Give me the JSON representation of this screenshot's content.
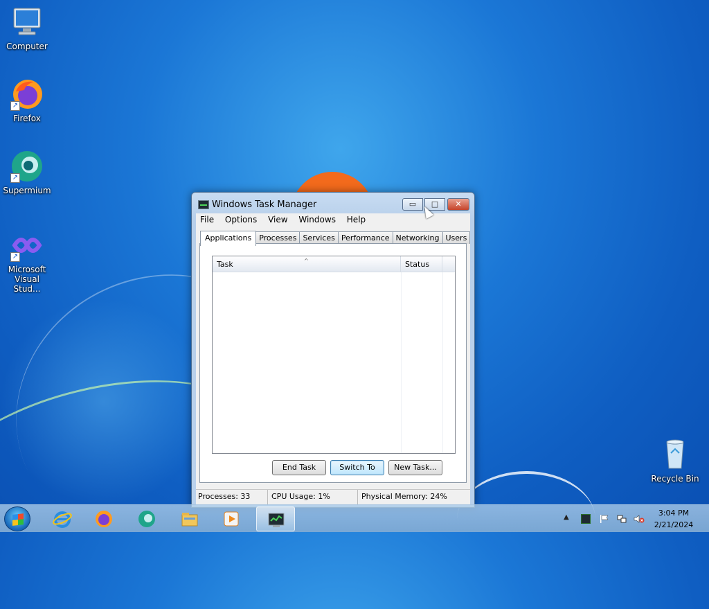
{
  "desktop": {
    "icons": [
      {
        "label": "Computer"
      },
      {
        "label": "Firefox"
      },
      {
        "label": "Supermium"
      },
      {
        "label": "Microsoft Visual Stud..."
      },
      {
        "label": "Recycle Bin"
      }
    ]
  },
  "window": {
    "title": "Windows Task Manager",
    "controls": {
      "minimize": "▭",
      "maximize": "□",
      "close": "✕"
    },
    "menu": [
      "File",
      "Options",
      "View",
      "Windows",
      "Help"
    ],
    "tabs": [
      "Applications",
      "Processes",
      "Services",
      "Performance",
      "Networking",
      "Users"
    ],
    "active_tab": "Applications",
    "list": {
      "columns": [
        "Task",
        "Status"
      ],
      "sort_indicator": "^",
      "rows": []
    },
    "buttons": {
      "end_task": "End Task",
      "switch_to": "Switch To",
      "new_task": "New Task..."
    },
    "status": {
      "processes": "Processes: 33",
      "cpu": "CPU Usage: 1%",
      "memory": "Physical Memory: 24%"
    }
  },
  "taskbar": {
    "pinned": [
      "internet-explorer-icon",
      "firefox-icon",
      "supermium-icon",
      "file-explorer-icon",
      "media-player-icon",
      "task-manager-icon"
    ],
    "clock": {
      "time": "3:04 PM",
      "date": "2/21/2024"
    }
  },
  "colors": {
    "accent": "#1b77d6",
    "close_button": "#c5432a",
    "taskbar": "#9cc0e0"
  }
}
